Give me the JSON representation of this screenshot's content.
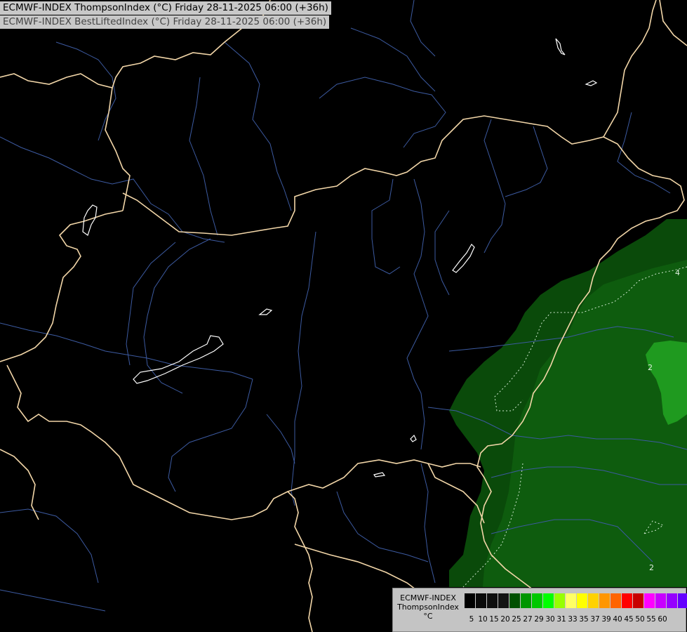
{
  "header": {
    "line1": "ECMWF-INDEX ThompsonIndex (°C) Friday 28-11-2025 06:00 (+36h)",
    "line2": "ECMWF-INDEX BestLiftedIndex (°C) Friday 28-11-2025 06:00 (+36h)"
  },
  "contour_labels": {
    "a": "4",
    "b": "2",
    "c": "2"
  },
  "legend": {
    "title_lines": [
      "ECMWF-INDEX",
      "ThompsonIndex",
      "°C"
    ],
    "colors": [
      "#000000",
      "#0a0a0a",
      "#0f0f0f",
      "#141414",
      "#005000",
      "#009600",
      "#00c800",
      "#00ff00",
      "#96ff00",
      "#ffff64",
      "#ffff00",
      "#ffd200",
      "#ff9600",
      "#ff6400",
      "#ff0000",
      "#c80000",
      "#ff00ff",
      "#c800ff",
      "#9600ff",
      "#6400ff",
      "#0000ff"
    ],
    "ticks": [
      "5",
      "10",
      "15",
      "20",
      "25",
      "27",
      "29",
      "30",
      "31",
      "33",
      "35",
      "37",
      "39",
      "40",
      "45",
      "50",
      "55",
      "60"
    ]
  },
  "colors": {
    "border": "#f2d6a8",
    "river": "#3c5aa0",
    "lake": "#ffffff",
    "field_dark": "#0a4a0a",
    "field_mid": "#0e5c0e",
    "field_bright": "#22a022"
  }
}
